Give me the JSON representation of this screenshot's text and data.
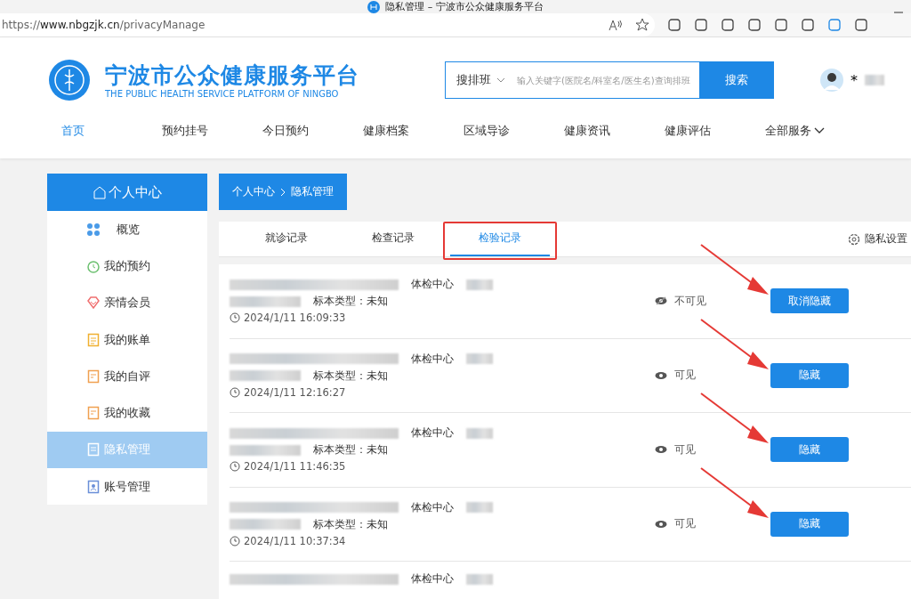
{
  "browser": {
    "title": "隐私管理 – 宁波市公众健康服务平台",
    "url_scheme": "https://",
    "url_host": "www.nbgzjk.cn",
    "url_path": "/privacyManage"
  },
  "header": {
    "title": "宁波市公众健康服务平台",
    "subtitle": "THE PUBLIC HEALTH SERVICE PLATFORM OF NINGBO",
    "search_scope": "搜排班",
    "search_placeholder": "输入关键字(医院名/科室名/医生名)查询排班",
    "search_button": "搜索",
    "user_name": "*"
  },
  "nav": [
    {
      "label": "首页",
      "selected": true
    },
    {
      "label": "预约挂号",
      "selected": false
    },
    {
      "label": "今日预约",
      "selected": false
    },
    {
      "label": "健康档案",
      "selected": false
    },
    {
      "label": "区域导诊",
      "selected": false
    },
    {
      "label": "健康资讯",
      "selected": false
    },
    {
      "label": "健康评估",
      "selected": false
    },
    {
      "label": "全部服务",
      "selected": false,
      "dropdown": true
    }
  ],
  "sidebar": {
    "title": "个人中心",
    "items": [
      {
        "label": "概览",
        "kind": "grid",
        "selected": false
      },
      {
        "label": "我的预约",
        "kind": "alarm",
        "selected": false
      },
      {
        "label": "亲情会员",
        "kind": "gem",
        "selected": false
      },
      {
        "label": "我的账单",
        "kind": "bill",
        "selected": false
      },
      {
        "label": "我的自评",
        "kind": "note",
        "selected": false
      },
      {
        "label": "我的收藏",
        "kind": "note",
        "selected": false
      },
      {
        "label": "隐私管理",
        "kind": "privacy",
        "selected": true
      },
      {
        "label": "账号管理",
        "kind": "account",
        "selected": false
      }
    ]
  },
  "breadcrumb": [
    "个人中心",
    "隐私管理"
  ],
  "tabs": [
    {
      "label": "就诊记录",
      "selected": false,
      "highlighted": false
    },
    {
      "label": "检查记录",
      "selected": false,
      "highlighted": false
    },
    {
      "label": "检验记录",
      "selected": true,
      "highlighted": true
    }
  ],
  "privacy_settings": "隐私设置",
  "records": [
    {
      "center": "体检中心",
      "specimen": "标本类型：未知",
      "time": "2024/1/11 16:09:33",
      "visible": false,
      "visibility": "不可见",
      "action": "取消隐藏",
      "arrow": true
    },
    {
      "center": "体检中心",
      "specimen": "标本类型：未知",
      "time": "2024/1/11 12:16:27",
      "visible": true,
      "visibility": "可见",
      "action": "隐藏",
      "arrow": true
    },
    {
      "center": "体检中心",
      "specimen": "标本类型：未知",
      "time": "2024/1/11 11:46:35",
      "visible": true,
      "visibility": "可见",
      "action": "隐藏",
      "arrow": true
    },
    {
      "center": "体检中心",
      "specimen": "标本类型：未知",
      "time": "2024/1/11 10:37:34",
      "visible": true,
      "visibility": "可见",
      "action": "隐藏",
      "arrow": true
    },
    {
      "center": "体检中心"
    }
  ]
}
